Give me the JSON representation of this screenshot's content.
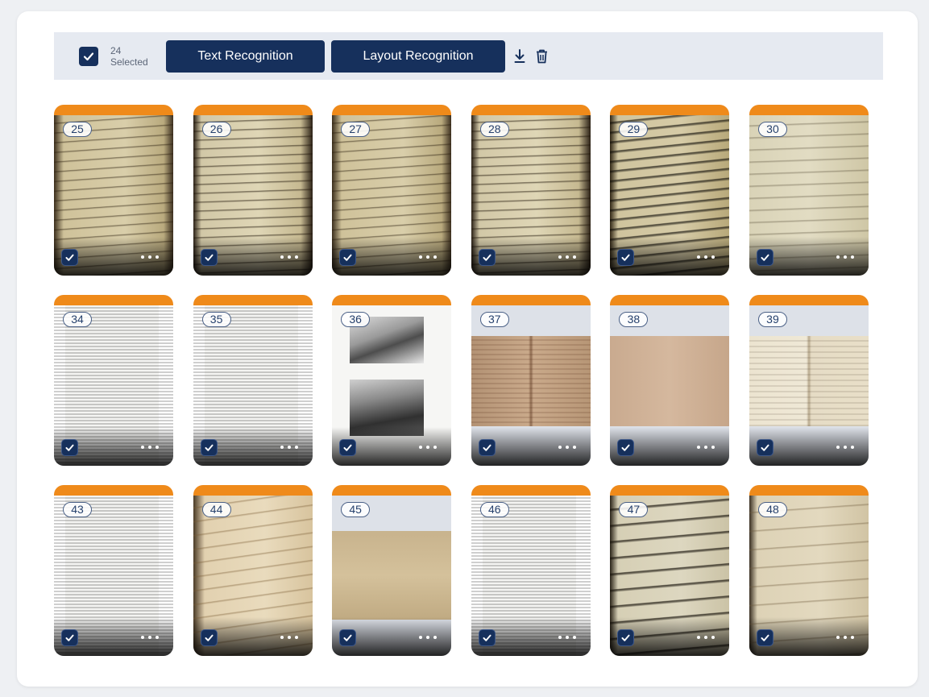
{
  "toolbar": {
    "selected_label": "24 Selected",
    "text_recognition_label": "Text Recognition",
    "layout_recognition_label": "Layout Recognition",
    "download_icon": "download-icon",
    "delete_icon": "trash-icon"
  },
  "colors": {
    "primary": "#16305c",
    "accent_band": "#ef8a1a",
    "toolbar_bg": "#e6eaf1"
  },
  "cards": [
    {
      "number": "25",
      "type": "handwritten-dark",
      "selected": true
    },
    {
      "number": "26",
      "type": "handwritten-dark",
      "selected": true
    },
    {
      "number": "27",
      "type": "handwritten-dark",
      "selected": true
    },
    {
      "number": "28",
      "type": "handwritten-dark",
      "selected": true
    },
    {
      "number": "29",
      "type": "handwritten-bold",
      "selected": true
    },
    {
      "number": "30",
      "type": "handwritten-faint",
      "selected": true
    },
    {
      "number": "34",
      "type": "printed-text",
      "selected": true
    },
    {
      "number": "35",
      "type": "printed-text",
      "selected": true
    },
    {
      "number": "36",
      "type": "photo-page",
      "selected": true
    },
    {
      "number": "37",
      "type": "manuscript-spread",
      "selected": true
    },
    {
      "number": "38",
      "type": "blank-spread",
      "selected": true
    },
    {
      "number": "39",
      "type": "light-spread",
      "selected": true
    },
    {
      "number": "43",
      "type": "printed-text",
      "selected": true
    },
    {
      "number": "44",
      "type": "letter",
      "selected": true
    },
    {
      "number": "45",
      "type": "tan-page",
      "selected": true
    },
    {
      "number": "46",
      "type": "printed-text",
      "selected": true
    },
    {
      "number": "47",
      "type": "cursive-bold",
      "selected": true
    },
    {
      "number": "48",
      "type": "cursive-light",
      "selected": true
    }
  ]
}
